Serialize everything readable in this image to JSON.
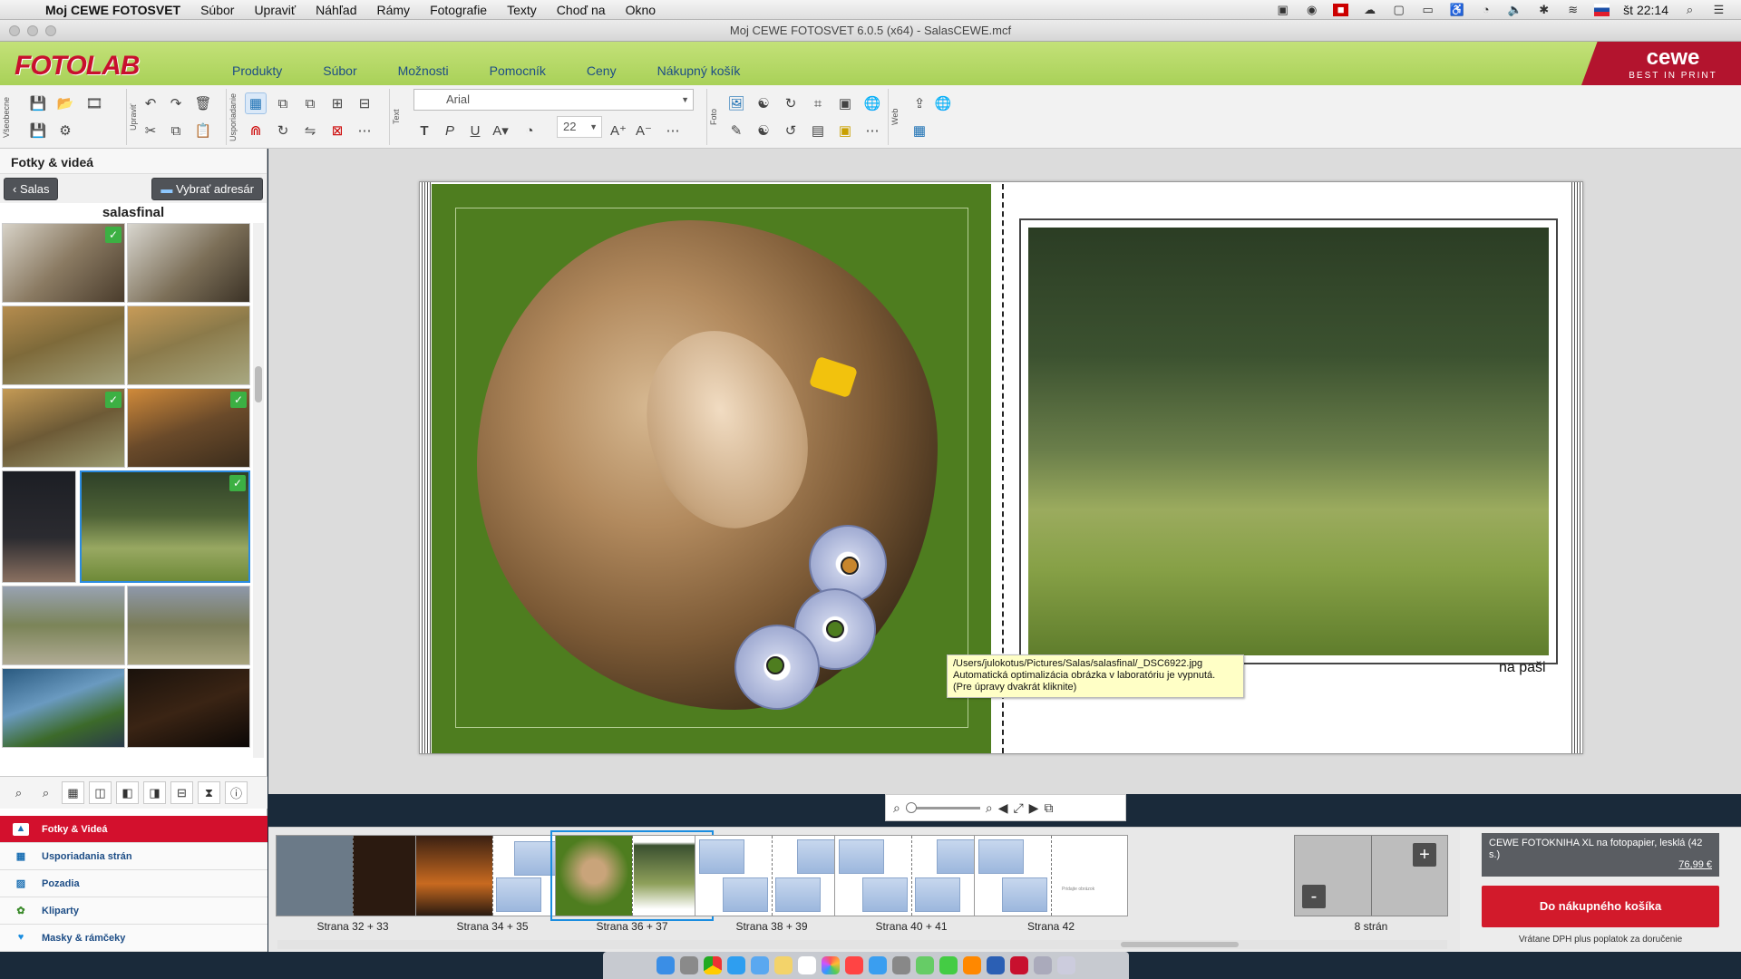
{
  "menubar": {
    "app_name": "Moj CEWE FOTOSVET",
    "items": [
      "Súbor",
      "Upraviť",
      "Náhľad",
      "Rámy",
      "Fotografie",
      "Texty",
      "Choď na",
      "Okno"
    ],
    "clock": "št 22:14"
  },
  "window": {
    "title": "Moj CEWE FOTOSVET 6.0.5 (x64) - SalasCEWE.mcf"
  },
  "brand": {
    "logo": "FOTOLAB",
    "menu": [
      "Produkty",
      "Súbor",
      "Možnosti",
      "Pomocník",
      "Ceny",
      "Nákupný košík"
    ],
    "cewe": "cewe",
    "cewe_tagline": "BEST IN PRINT"
  },
  "toolbar": {
    "groups": [
      "Všeobecne",
      "Upraviť",
      "Usporiadanie",
      "Text",
      "Foto",
      "Web"
    ],
    "font_name": "Arial",
    "font_size": "22"
  },
  "left_panel": {
    "title": "Fotky & videá",
    "back_label": "Salas",
    "choose_folder_label": "Vybrať adresár",
    "folder_name": "salasfinal"
  },
  "side_nav": [
    {
      "label": "Fotky & Videá",
      "icon": "photos-icon"
    },
    {
      "label": "Usporiadania strán",
      "icon": "layouts-icon"
    },
    {
      "label": "Pozadia",
      "icon": "backgrounds-icon"
    },
    {
      "label": "Kliparty",
      "icon": "cliparts-icon"
    },
    {
      "label": "Masky & rámčeky",
      "icon": "masks-icon"
    }
  ],
  "canvas": {
    "caption": "na paši",
    "tooltip_path": "/Users/julokotus/Pictures/Salas/salasfinal/_DSC6922.jpg",
    "tooltip_line2": "Automatická optimalizácia obrázka v laboratóriu je vypnutá.",
    "tooltip_line3": "(Pre úpravy dvakrát kliknite)"
  },
  "pages": [
    {
      "label": "Strana 32 + 33"
    },
    {
      "label": "Strana 34 + 35"
    },
    {
      "label": "Strana 36 + 37"
    },
    {
      "label": "Strana 38 + 39"
    },
    {
      "label": "Strana 40 + 41"
    },
    {
      "label": "Strana 42"
    },
    {
      "label": "8 strán"
    }
  ],
  "page42_text": "Pridajte obrázok",
  "cart": {
    "product": "CEWE FOTOKNIHA XL na fotopapier, lesklá (42 s.)",
    "price": "76,99 €",
    "button": "Do nákupného košíka",
    "vat_note": "Vrátane DPH plus poplatok za doručenie"
  },
  "colors": {
    "accent": "#d21a2b",
    "brand_green": "#a9d158",
    "page_green": "#4e7d1f"
  }
}
